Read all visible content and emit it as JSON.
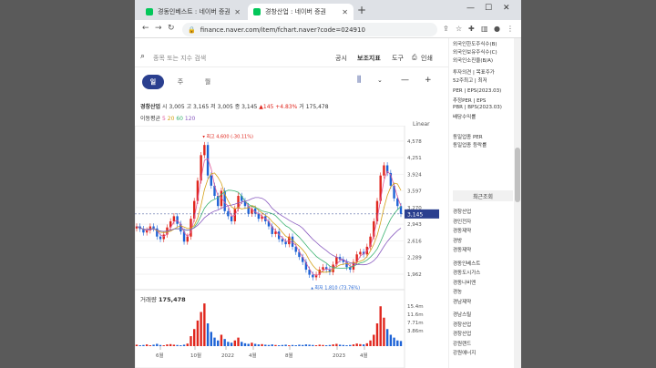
{
  "tabs": [
    {
      "title": "경동인베스트 : 네이버 증권"
    },
    {
      "title": "경창산업 : 네이버 증권"
    }
  ],
  "address": "finance.naver.com/item/fchart.naver?code=024910",
  "search": {
    "placeholder": "종목 또는 지수 검색"
  },
  "menu": [
    "공시",
    "보조지표",
    "도구",
    "인쇄"
  ],
  "periods": [
    "일",
    "주",
    "월"
  ],
  "info": {
    "name": "경창산업",
    "open_label": "시",
    "open": "3,005",
    "high_label": "고",
    "high": "3,165",
    "low_label": "저",
    "low": "3,005",
    "close_label": "종",
    "close": "3,145",
    "change": "▲145",
    "change_pct": "+4.83%",
    "volume_label": "거",
    "volume": "175,478"
  },
  "ma": {
    "label": "이동평균",
    "v5": "5",
    "v20": "20",
    "v60": "60",
    "v120": "120"
  },
  "scale_label": "Linear",
  "volume_header": {
    "label": "거래량",
    "value": "175,478"
  },
  "sidebar": {
    "top_items": [
      "외국인한도주식수(B)",
      "외국인보유주식수(C)",
      "외국인소진율(B/A)",
      "투자의견 | 목표주가",
      "52주최고 | 최저",
      "PER | EPS(2023.03)",
      "추정PER | EPS",
      "PBR | BPS(2023.03)",
      "배당수익률",
      "동일업종 PER",
      "동일업종 등락률"
    ],
    "recent_label": "최근조회",
    "recent_items": [
      "경창산업",
      "경인전자",
      "경동제약",
      "경방",
      "경동제약",
      "경동인베스트",
      "경동도시가스",
      "경동나비엔",
      "경농",
      "경남제약",
      "경남스틸",
      "경창산업",
      "경창산업",
      "강원랜드",
      "강원에너지"
    ]
  },
  "chart_data": {
    "type": "candlestick",
    "x_ticks": [
      "6월",
      "10월",
      "2022",
      "4월",
      "8월",
      "2023",
      "4월"
    ],
    "y_ticks": [
      1962,
      2289,
      2616,
      2943,
      3270,
      3597,
      3924,
      4251,
      4578
    ],
    "ylim": [
      1800,
      4700
    ],
    "current_price": 3145,
    "current_price_label": "3,145",
    "max_annotation": {
      "label": "최고 4,600 (-30.11%)",
      "value": 4600
    },
    "min_annotation": {
      "label": "최저 1,810 (73.76%)",
      "value": 1810
    },
    "volume_ticks": [
      "15.4m",
      "11.6m",
      "7.71m",
      "3.86m"
    ],
    "series_close": [
      2900,
      2850,
      2780,
      2820,
      2900,
      2860,
      2700,
      2650,
      2740,
      2880,
      3000,
      3100,
      2950,
      2800,
      2600,
      2700,
      3050,
      3400,
      3800,
      4300,
      4500,
      3900,
      3700,
      3500,
      3300,
      3600,
      3200,
      3100,
      3000,
      3250,
      3500,
      3400,
      3300,
      3150,
      3250,
      3150,
      3050,
      3100,
      3000,
      2900,
      2750,
      2800,
      2650,
      2600,
      2550,
      2700,
      2500,
      2400,
      2300,
      2200,
      2050,
      1950,
      1900,
      1950,
      2050,
      2100,
      2050,
      2000,
      2150,
      2300,
      2250,
      2200,
      2100,
      2050,
      2200,
      2350,
      2400,
      2350,
      2500,
      2700,
      3000,
      3400,
      3900,
      4100,
      3950,
      3700,
      3450,
      3300,
      3145
    ],
    "volumes": [
      0.5,
      0.3,
      0.4,
      0.6,
      0.3,
      0.5,
      0.8,
      0.4,
      0.3,
      0.6,
      0.7,
      0.5,
      0.4,
      0.3,
      0.5,
      0.9,
      3.5,
      6.0,
      9.0,
      12.0,
      15.0,
      8.0,
      5.0,
      3.0,
      2.0,
      4.0,
      2.5,
      1.5,
      1.2,
      2.0,
      3.0,
      1.5,
      1.0,
      0.8,
      1.2,
      0.8,
      0.6,
      0.7,
      0.5,
      0.4,
      0.6,
      0.4,
      0.3,
      0.4,
      0.5,
      0.3,
      0.4,
      0.3,
      0.5,
      0.4,
      0.6,
      0.5,
      0.4,
      0.3,
      0.5,
      0.4,
      0.3,
      0.4,
      0.6,
      0.8,
      0.5,
      0.4,
      0.3,
      0.4,
      0.6,
      0.9,
      0.7,
      0.6,
      1.0,
      2.0,
      4.0,
      8.0,
      14.0,
      10.0,
      6.0,
      4.0,
      3.0,
      2.0,
      1.8
    ]
  }
}
